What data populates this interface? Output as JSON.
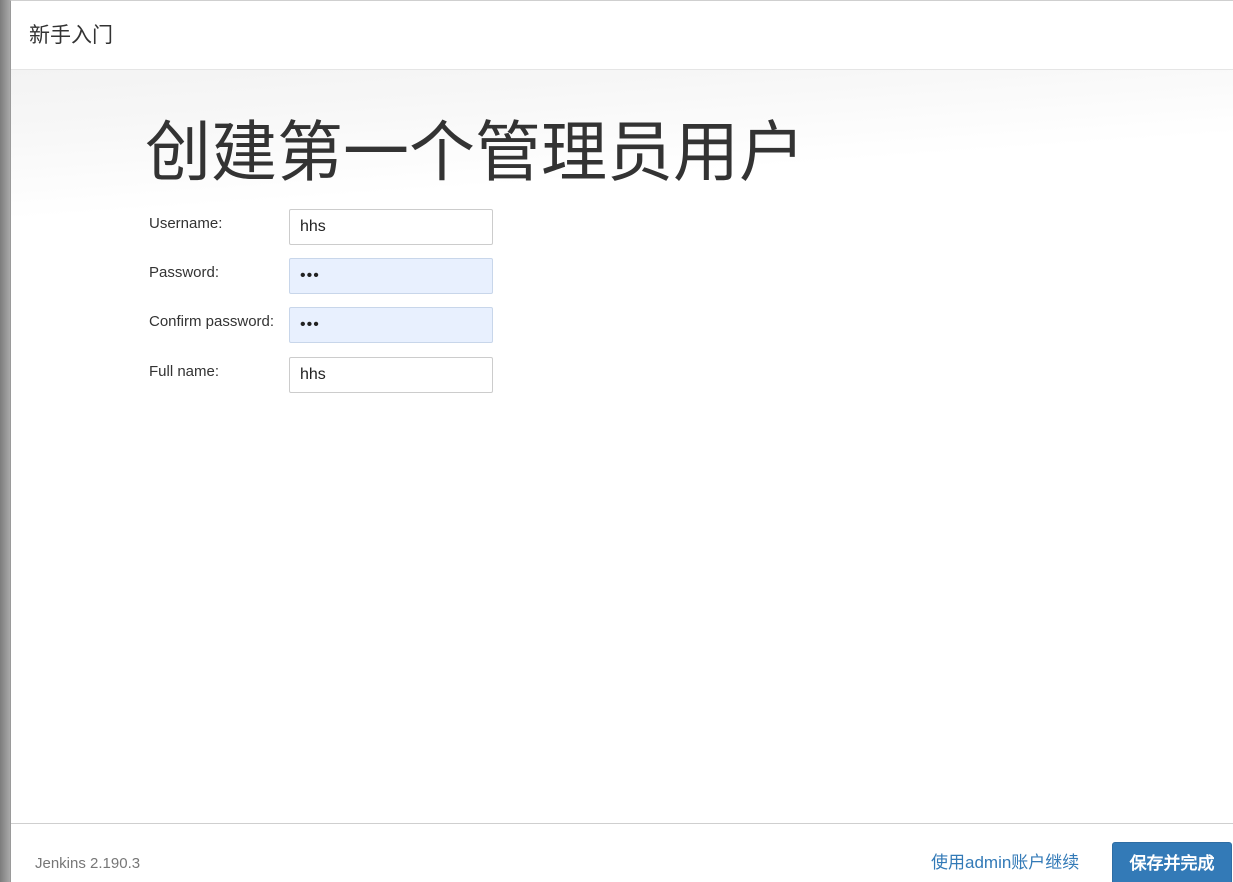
{
  "dialog": {
    "title": "新手入门"
  },
  "form": {
    "heading": "创建第一个管理员用户",
    "fields": [
      {
        "label": "Username:",
        "value": "hhs",
        "type": "text"
      },
      {
        "label": "Password:",
        "value": "•••",
        "type": "password"
      },
      {
        "label": "Confirm password:",
        "value": "•••",
        "type": "password"
      },
      {
        "label": "Full name:",
        "value": "hhs",
        "type": "text"
      }
    ]
  },
  "footer": {
    "version": "Jenkins 2.190.3",
    "continue_link": "使用admin账户继续",
    "save_label": "保存并完成"
  },
  "colors": {
    "accent": "#337ab7",
    "autofill": "#e8f0fe"
  }
}
